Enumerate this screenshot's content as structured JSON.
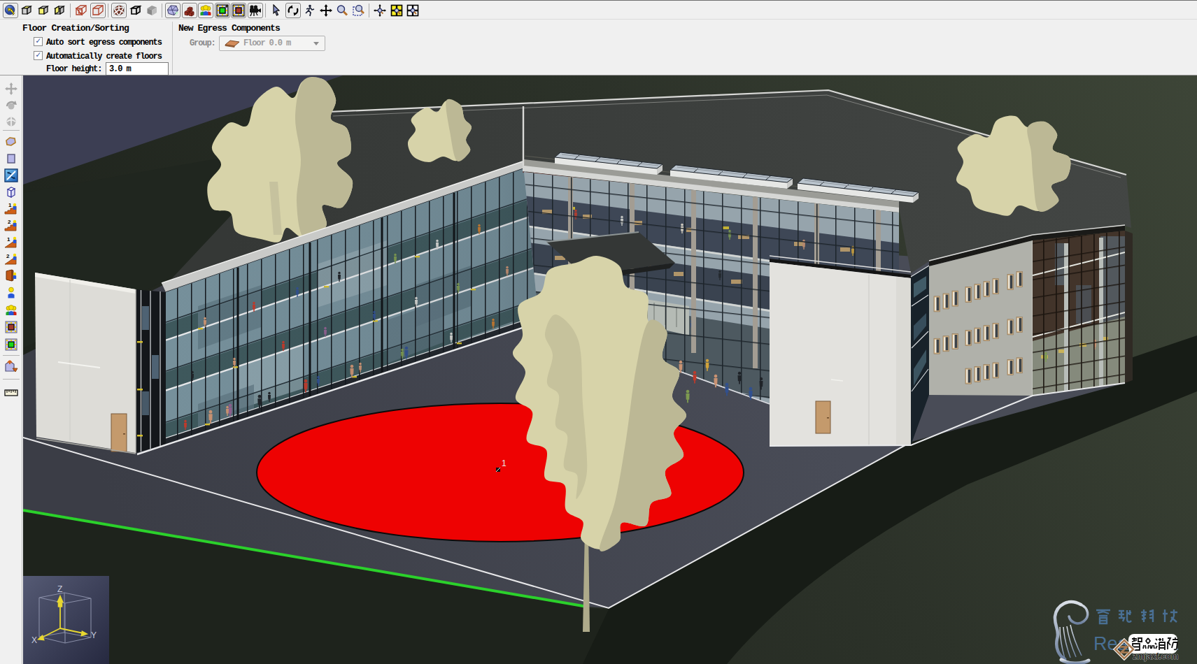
{
  "panels": {
    "floor": {
      "title": "Floor Creation/Sorting",
      "check1": "Auto sort egress components",
      "check1_checked": true,
      "check2": "Automatically create floors",
      "check2_checked": true,
      "height_label": "Floor height:",
      "height_value": "3.0 m"
    },
    "egress": {
      "title": "New Egress Components",
      "group_label": "Group:",
      "group_value": "Floor 0.0 m"
    }
  },
  "toolbar_top": {
    "icons": [
      "select-object",
      "view-top",
      "view-front",
      "view-side",
      "wireframe-faces",
      "wireframe",
      "textured-cube",
      "outline-cube",
      "solid-cube",
      "show-geometry",
      "show-objects",
      "show-occupants",
      "show-exits",
      "show-measurement-regions",
      "show-cameras",
      "select-tool",
      "orbit-tool",
      "walk-tool",
      "pan-tool",
      "zoom-tool",
      "zoom-box-tool",
      "center-view",
      "zoom-fit-all",
      "zoom-fit-selection"
    ]
  },
  "toolbar_left": {
    "icons": [
      "move-disabled",
      "rotate-disabled",
      "mirror-disabled",
      "polygon-room",
      "rectangle-room",
      "thin-wall",
      "prism",
      "stair-one-floor",
      "stair-two-floor",
      "ramp-one-floor",
      "ramp-two-floor",
      "door",
      "add-occupant",
      "add-occupant-group",
      "measurement-region",
      "exit-region",
      "extract-floor",
      "measure-tool"
    ]
  },
  "viewport": {
    "axis": {
      "x": "X",
      "y": "Y",
      "z": "Z"
    },
    "marker_label": "1",
    "watermark": {
      "company_cn": "睿驰科技",
      "company_en": "Reachsoft",
      "badge_cn": "智淼消防",
      "badge_site": "zmjaxf.com"
    },
    "scene": {
      "sky_color": "#3c3e53",
      "ground_color": "#2a2f27",
      "plaza_color": "#43454f",
      "refuge_circle_color": "#ee0202",
      "measure_line_color": "#2bd12b",
      "roof_color": "#3f423f",
      "tree_color": "#d7d3a9"
    }
  }
}
